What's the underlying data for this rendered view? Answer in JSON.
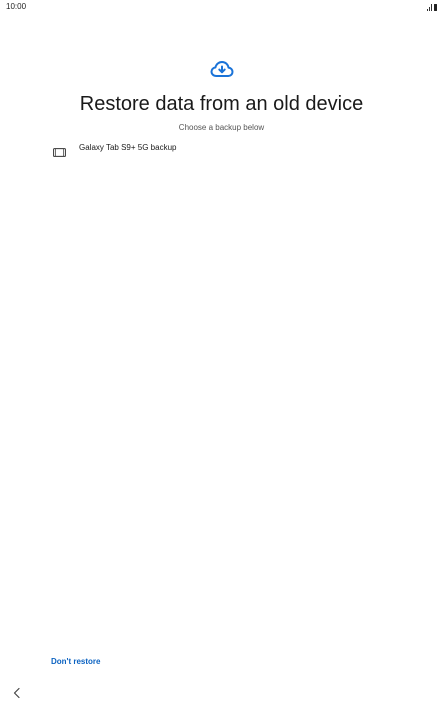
{
  "status_bar": {
    "time": "10:00",
    "icons": [
      "signal-icon",
      "battery-icon"
    ]
  },
  "main": {
    "header_icon": "cloud-download-icon",
    "title": "Restore data from an old device",
    "subtitle": "Choose a backup below",
    "backups": [
      {
        "icon": "tablet-icon",
        "label": "Galaxy Tab S9+ 5G backup"
      }
    ]
  },
  "footer": {
    "dont_restore_label": "Don't restore"
  },
  "nav": {
    "back_icon": "back-chevron-icon"
  },
  "colors": {
    "accent": "#0b62c1",
    "icon_blue": "#1a73d8",
    "text": "#1a1a1a",
    "subtext": "#555555",
    "background": "#ffffff"
  }
}
